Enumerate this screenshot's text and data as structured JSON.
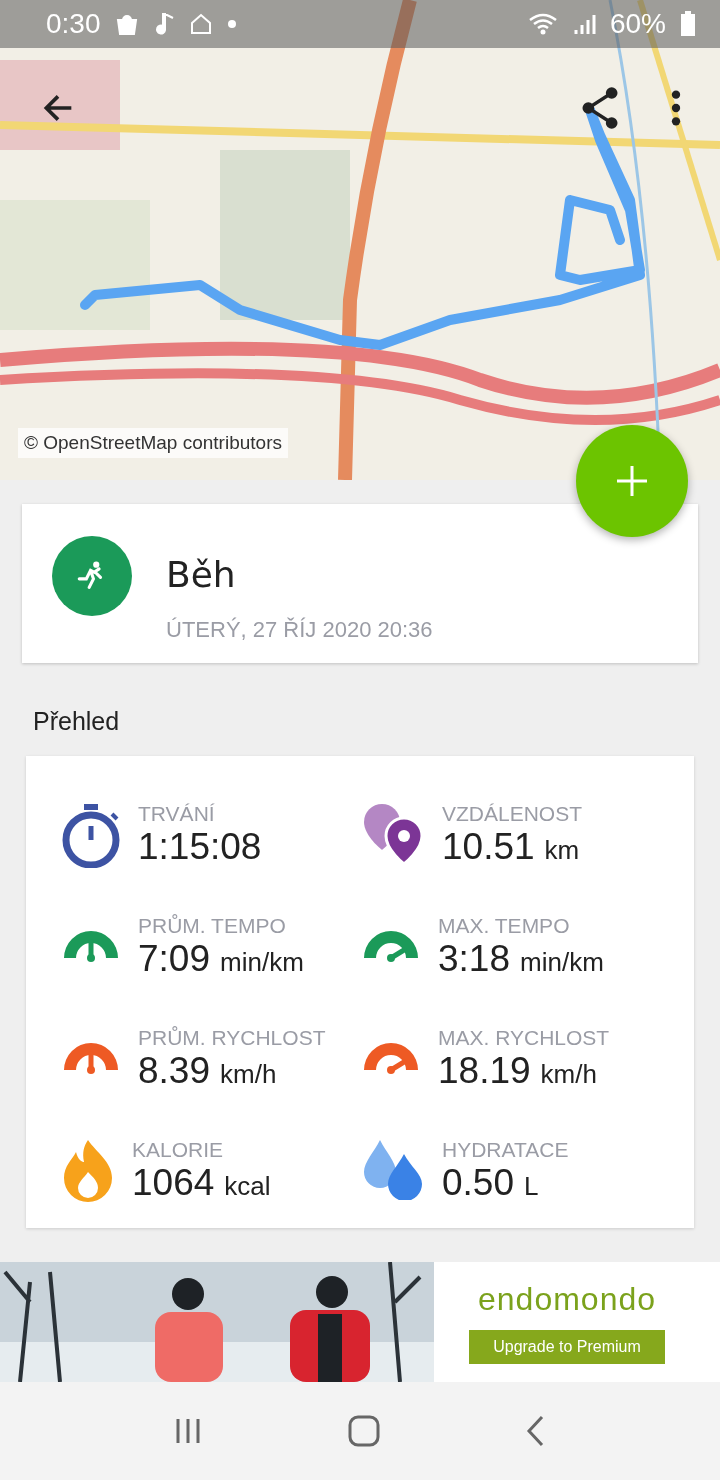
{
  "status_bar": {
    "time": "0:30",
    "battery": "60%"
  },
  "map": {
    "attribution": "© OpenStreetMap contributors"
  },
  "activity": {
    "title": "Běh",
    "date": "ÚTERÝ, 27 ŘÍJ 2020 20:36"
  },
  "overview": {
    "heading": "Přehled",
    "stats": [
      {
        "kind": "stopwatch",
        "label": "TRVÁNÍ",
        "value": "1:15:08"
      },
      {
        "kind": "pins",
        "label": "VZDÁLENOST",
        "value": "10.51",
        "unit": "km"
      },
      {
        "kind": "gauge-avg-green",
        "label": "PRŮM. TEMPO",
        "value": "7:09",
        "unit": "min/km"
      },
      {
        "kind": "gauge-max-green",
        "label": "MAX. TEMPO",
        "value": "3:18",
        "unit": "min/km"
      },
      {
        "kind": "gauge-avg-orange",
        "label": "PRŮM. RYCHLOST",
        "value": "8.39",
        "unit": "km/h"
      },
      {
        "kind": "gauge-max-orange",
        "label": "MAX. RYCHLOST",
        "value": "18.19",
        "unit": "km/h"
      },
      {
        "kind": "flame",
        "label": "KALORIE",
        "value": "1064",
        "unit": "kcal"
      },
      {
        "kind": "drops",
        "label": "HYDRATACE",
        "value": "0.50",
        "unit": "L"
      }
    ]
  },
  "ad": {
    "logo": "endomondo",
    "button": "Upgrade to Premium"
  }
}
